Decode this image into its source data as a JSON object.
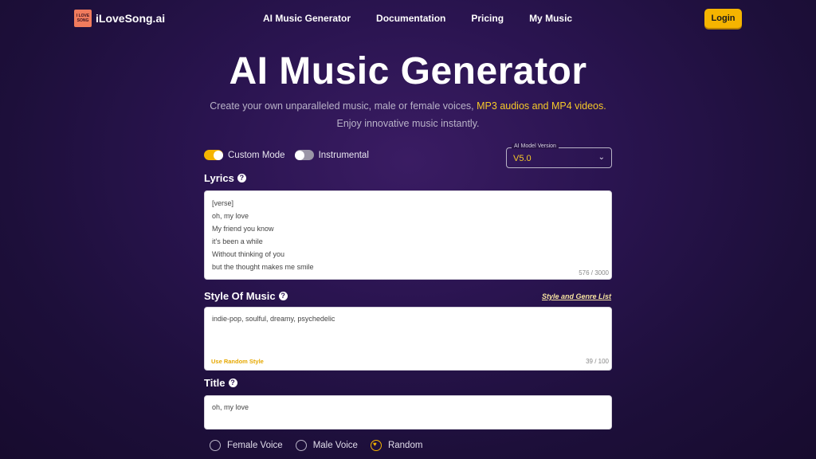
{
  "brand": {
    "logo_lines": [
      "I LOVE",
      "SONG"
    ],
    "name": "iLoveSong.ai"
  },
  "nav": {
    "links": [
      "AI Music Generator",
      "Documentation",
      "Pricing",
      "My Music"
    ],
    "login_label": "Login"
  },
  "hero": {
    "title": "AI Music Generator",
    "subtitle_part1": "Create your own unparalleled music, male or female voices, ",
    "subtitle_highlight": "MP3 audios and MP4 videos.",
    "subtitle_line2": "Enjoy innovative music instantly."
  },
  "modes": {
    "custom_label": "Custom Mode",
    "custom_on": true,
    "instrumental_label": "Instrumental",
    "instrumental_on": false
  },
  "model": {
    "legend": "AI Model Version",
    "value": "V5.0"
  },
  "lyrics": {
    "label": "Lyrics",
    "lines": [
      "[verse]",
      "oh, my love",
      "My friend you know",
      "it's been a while",
      "Without thinking of you",
      "but the thought makes me smile"
    ],
    "counter": "576 / 3000"
  },
  "style": {
    "label": "Style Of Music",
    "genre_link": "Style and Genre List",
    "value": "indie-pop, soulful, dreamy, psychedelic",
    "random_label": "Use Random Style",
    "counter": "39 / 100"
  },
  "title_field": {
    "label": "Title",
    "value": "oh, my love"
  },
  "voice": {
    "options": [
      "Female Voice",
      "Male Voice",
      "Random"
    ],
    "selected": "Random"
  },
  "colors": {
    "accent": "#f5b400",
    "highlight": "#f6c928",
    "background": "#2a1450"
  }
}
